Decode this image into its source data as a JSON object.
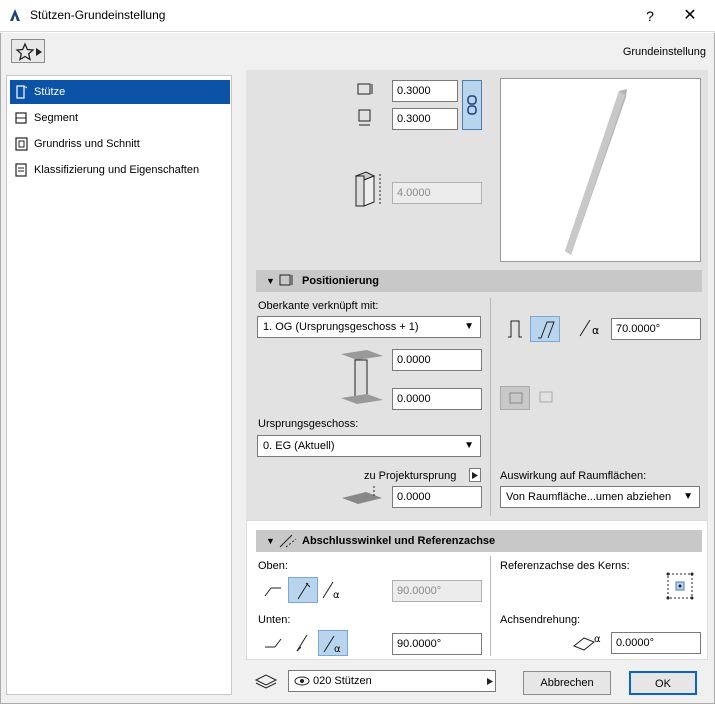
{
  "window": {
    "title": "Stützen-Grundeinstellung",
    "help_label": "?",
    "close_label": "✕",
    "preset_label": "Grundeinstellung"
  },
  "sidebar": {
    "items": [
      {
        "label": "Stütze",
        "icon": "column-icon",
        "active": true
      },
      {
        "label": "Segment",
        "icon": "segment-icon",
        "active": false
      },
      {
        "label": "Grundriss und Schnitt",
        "icon": "floorplan-section-icon",
        "active": false
      },
      {
        "label": "Klassifizierung und Eigenschaften",
        "icon": "classification-icon",
        "active": false
      }
    ]
  },
  "geometry": {
    "width": "0.3000",
    "depth": "0.3000",
    "height": "4.0000"
  },
  "positioning": {
    "header": "Positionierung",
    "top_linked_label": "Oberkante verknüpft mit:",
    "top_linked_value": "1. OG (Ursprungsgeschoss + 1)",
    "top_offset": "0.0000",
    "bottom_offset": "0.0000",
    "home_story_label": "Ursprungsgeschoss:",
    "home_story_value": "0. EG (Aktuell)",
    "project_zero_label": "zu Projektursprung",
    "project_zero_value": "0.0000",
    "slant_angle": "70.0000°",
    "zone_effect_label": "Auswirkung auf Raumflächen:",
    "zone_effect_value": "Von Raumfläche...umen abziehen"
  },
  "end_angle": {
    "header": "Abschlusswinkel und Referenzachse",
    "top_label": "Oben:",
    "top_value": "90.0000°",
    "bottom_label": "Unten:",
    "bottom_value": "90.0000°",
    "core_ref_label": "Referenzachse des Kerns:",
    "axis_rotation_label": "Achsendrehung:",
    "axis_rotation_value": "0.0000°"
  },
  "footer": {
    "layer_value": "020 Stützen",
    "cancel_label": "Abbrechen",
    "ok_label": "OK"
  },
  "colors": {
    "accent": "#0a53a6",
    "toggle_on": "#b9d5ee"
  }
}
